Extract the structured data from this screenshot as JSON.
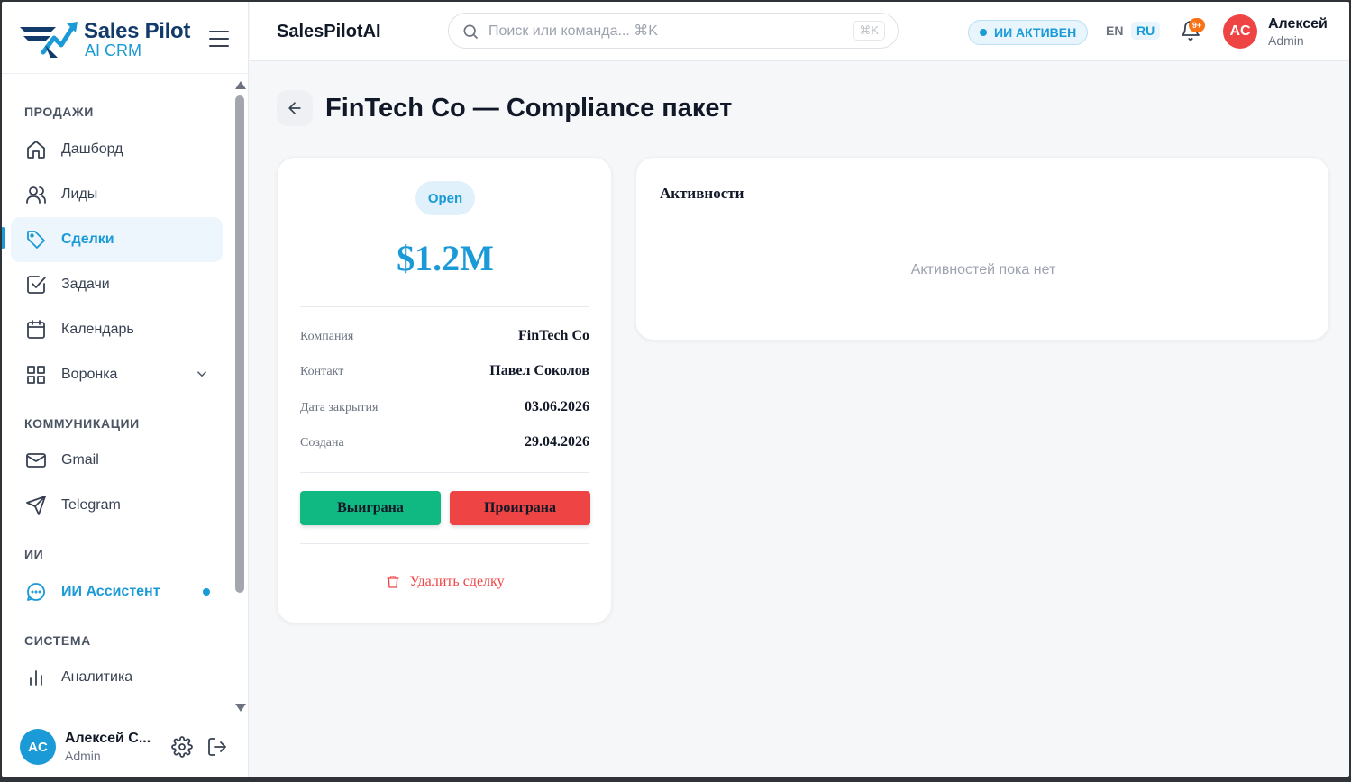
{
  "brand": {
    "name": "Sales Pilot",
    "sub": "AI CRM"
  },
  "sidebar": {
    "sections": [
      "ПРОДАЖИ",
      "КОММУНИКАЦИИ",
      "ИИ",
      "СИСТЕМА"
    ],
    "items": [
      {
        "label": "Дашборд",
        "icon": "home-icon"
      },
      {
        "label": "Лиды",
        "icon": "users-icon"
      },
      {
        "label": "Сделки",
        "icon": "tag-icon",
        "active": true
      },
      {
        "label": "Задачи",
        "icon": "check-square-icon"
      },
      {
        "label": "Календарь",
        "icon": "calendar-icon"
      },
      {
        "label": "Воронка",
        "icon": "grid-icon",
        "expandable": true
      },
      {
        "label": "Gmail",
        "icon": "mail-icon"
      },
      {
        "label": "Telegram",
        "icon": "send-icon"
      },
      {
        "label": "ИИ Ассистент",
        "icon": "ai-chat-icon",
        "highlight": true
      },
      {
        "label": "Аналитика",
        "icon": "bar-chart-icon"
      }
    ]
  },
  "footer_user": {
    "initials": "AC",
    "name": "Алексей С...",
    "role": "Admin"
  },
  "topbar": {
    "app_title": "SalesPilotAI",
    "search_placeholder": "Поиск или команда... ⌘K",
    "search_kbd": "⌘K",
    "ai_status": "ИИ АКТИВЕН",
    "lang_en": "EN",
    "lang_ru": "RU",
    "notifications_badge": "9+",
    "user_initials": "AC",
    "user_name": "Алексей",
    "user_role": "Admin"
  },
  "page": {
    "title": "FinTech Co — Compliance пакет"
  },
  "deal": {
    "status": "Open",
    "amount": "$1.2M",
    "fields": [
      {
        "key": "Компания",
        "value": "FinTech Co"
      },
      {
        "key": "Контакт",
        "value": "Павел Соколов"
      },
      {
        "key": "Дата закрытия",
        "value": "03.06.2026"
      },
      {
        "key": "Создана",
        "value": "29.04.2026"
      }
    ],
    "won_label": "Выиграна",
    "lost_label": "Проиграна",
    "delete_label": "Удалить сделку"
  },
  "activity": {
    "title": "Активности",
    "empty_text": "Активностей пока нет"
  },
  "colors": {
    "accent": "#1a9ad6",
    "brand_dark": "#123a6b",
    "success": "#10b981",
    "danger": "#ef4444"
  }
}
